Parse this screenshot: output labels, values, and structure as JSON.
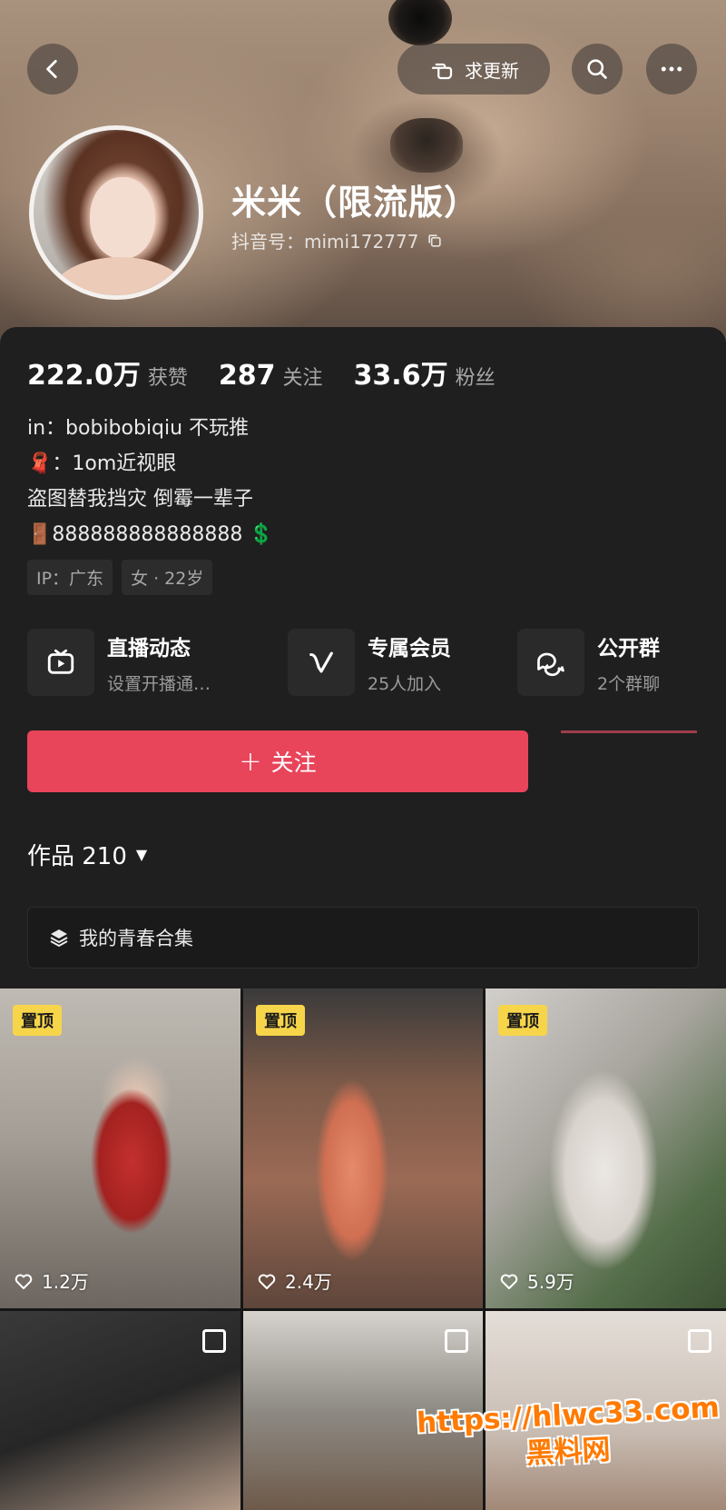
{
  "header": {
    "request_update_label": "求更新",
    "username": "米米（限流版）",
    "douyin_id": "抖音号：mimi172777"
  },
  "stats": [
    {
      "value": "222.0万",
      "label": "获赞"
    },
    {
      "value": "287",
      "label": "关注"
    },
    {
      "value": "33.6万",
      "label": "粉丝"
    }
  ],
  "bio": {
    "line1": "in：bobibobiqiu 不玩推",
    "line2": "🧣：1om近视眼",
    "line3": "盗图替我挡灾 倒霉一辈子",
    "line4": "🚪888888888888888 💲"
  },
  "tags": [
    "IP：广东",
    "女 · 22岁"
  ],
  "features": [
    {
      "title": "直播动态",
      "subtitle": "设置开播通…",
      "icon": "tv-icon"
    },
    {
      "title": "专属会员",
      "subtitle": "25人加入",
      "icon": "v-icon"
    },
    {
      "title": "公开群",
      "subtitle": "2个群聊",
      "icon": "chat-icon"
    }
  ],
  "follow_label": "关注",
  "works": {
    "label": "作品 210"
  },
  "collection_label": "我的青春合集",
  "posts": [
    {
      "pinned": "置顶",
      "likes": "1.2万"
    },
    {
      "pinned": "置顶",
      "likes": "2.4万"
    },
    {
      "pinned": "置顶",
      "likes": "5.9万"
    }
  ],
  "watermark": {
    "url": "https://hlwc33.com",
    "name": "黑料网"
  },
  "colors": {
    "accent": "#e8445a",
    "pin": "#f7d54a",
    "panel": "#1f1f1f"
  }
}
